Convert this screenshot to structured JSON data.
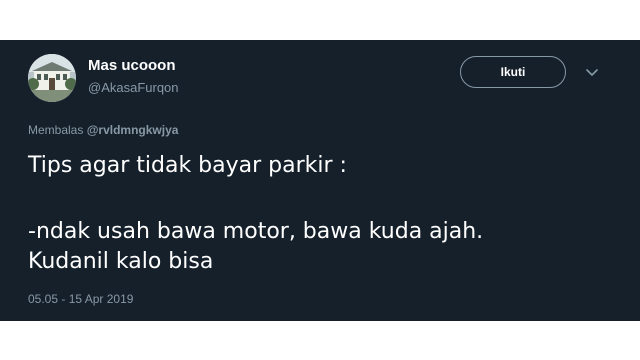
{
  "tweet": {
    "display_name": "Mas ucooon",
    "handle": "@AkasaFurqon",
    "follow_label": "Ikuti",
    "reply_prefix": "Membalas",
    "reply_to": "@rvldmngkwjya",
    "text_line_1": "Tips agar tidak bayar parkir :",
    "text_line_2": "-ndak usah bawa motor, bawa kuda ajah.",
    "text_line_3": "Kudanil kalo bisa",
    "timestamp": "05.05 - 15 Apr 2019"
  },
  "colors": {
    "background": "#15202b",
    "text_primary": "#ffffff",
    "text_secondary": "#8899a6",
    "page_background": "#ffffff"
  },
  "icons": {
    "avatar": "avatar-building-photo",
    "more": "chevron-down-icon"
  }
}
